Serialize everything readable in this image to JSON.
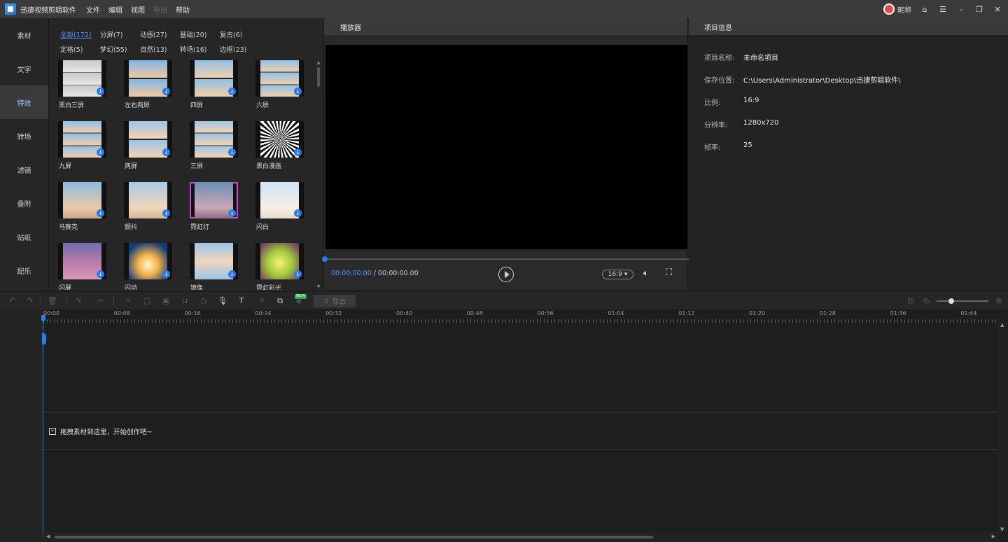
{
  "menubar": {
    "app_title": "迅捷视频剪辑软件",
    "menus": [
      "文件",
      "编辑",
      "视图",
      "导出",
      "帮助"
    ],
    "nickname": "昵称"
  },
  "leftnav": {
    "items": [
      "素材",
      "文字",
      "特效",
      "转场",
      "滤镜",
      "叠附",
      "贴纸",
      "配乐"
    ],
    "active": "特效"
  },
  "library": {
    "categories": [
      "全部(172)",
      "分屏(7)",
      "动感(27)",
      "基础(20)",
      "复古(6)",
      "定格(5)",
      "梦幻(55)",
      "自然(13)",
      "转场(16)",
      "边框(23)"
    ],
    "active_category": "全部(172)",
    "effects": [
      "黑白三屏",
      "左右两屏",
      "四屏",
      "六屏",
      "九屏",
      "两屏",
      "三屏",
      "黑白漫画",
      "马赛克",
      "颤抖",
      "霓虹灯",
      "闪白",
      "闪屏",
      "闪动",
      "镜像",
      "霓虹彩光"
    ],
    "download_glyph": "↓"
  },
  "player": {
    "title": "播放器",
    "current_time": "00:00:00.00",
    "separator": " / ",
    "total_time": "00:00:00.00",
    "ratio": "16:9",
    "accent": "#2b7bea"
  },
  "project_info": {
    "title": "项目信息",
    "rows": [
      {
        "label": "项目名称:",
        "value": "未命名项目"
      },
      {
        "label": "保存位置:",
        "value": "C:\\Users\\Administrator\\Desktop\\迅捷剪辑软件\\"
      },
      {
        "label": "比例:",
        "value": "16:9"
      },
      {
        "label": "分辨率:",
        "value": "1280x720"
      },
      {
        "label": "帧率:",
        "value": "25"
      }
    ]
  },
  "toolbar": {
    "new_badge": "NEW",
    "export_label": "导出"
  },
  "timeline": {
    "ruler_labels": [
      "00:00",
      "00:08",
      "00:16",
      "00:24",
      "00:32",
      "00:40",
      "00:48",
      "00:56",
      "01:04",
      "01:12",
      "01:20",
      "01:28",
      "01:36",
      "01:44"
    ],
    "drop_hint": "拖拽素材到这里，开始创作吧~"
  }
}
